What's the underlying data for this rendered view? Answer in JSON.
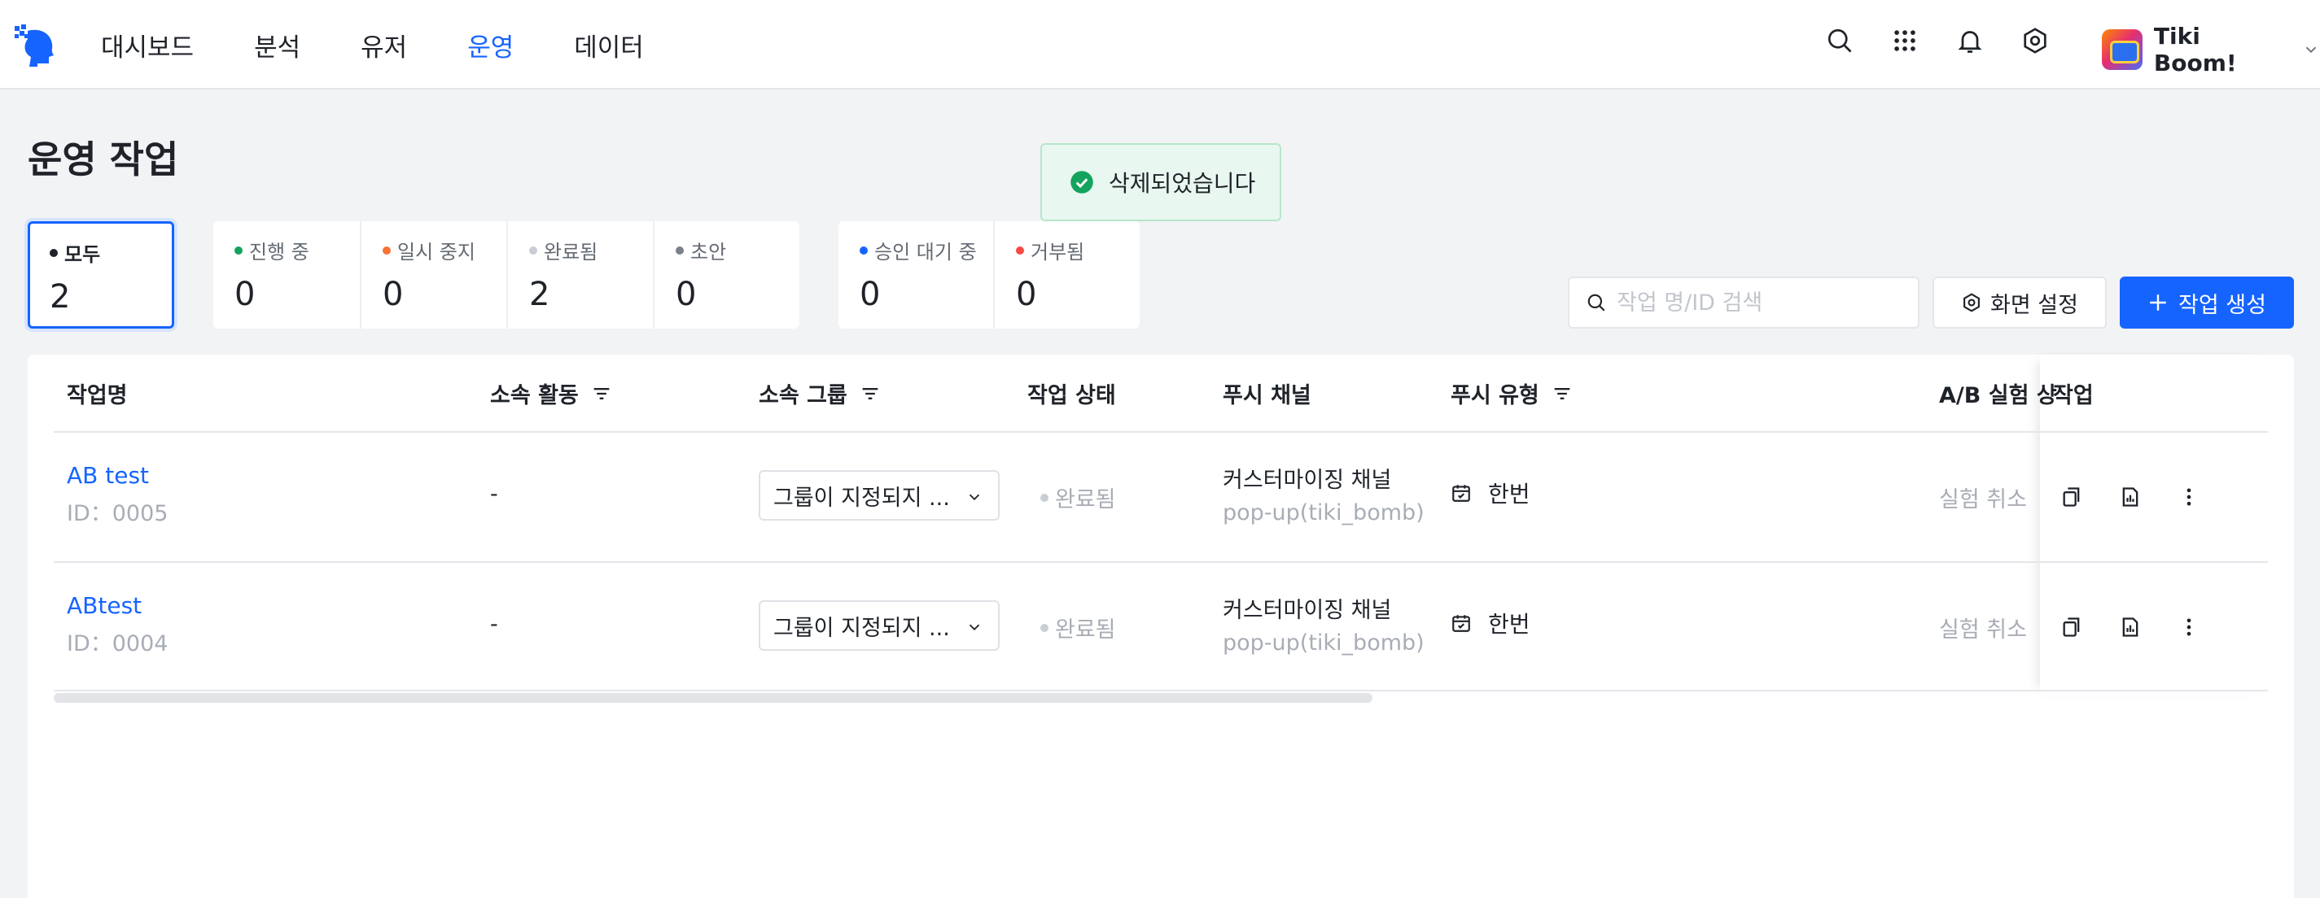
{
  "nav": {
    "items": [
      "대시보드",
      "분석",
      "유저",
      "운영",
      "데이터"
    ],
    "active": "운영"
  },
  "header_icons": [
    "search-icon",
    "apps-grid-icon",
    "bell-icon",
    "gear-icon"
  ],
  "user": {
    "name": "Tiki Boom!"
  },
  "page": {
    "title": "운영 작업"
  },
  "toast": {
    "message": "삭제되었습니다"
  },
  "status_cards": [
    {
      "label": "모두",
      "count": "2",
      "color": "#1f2329"
    },
    {
      "label": "진행 중",
      "count": "0",
      "color": "#14a35e"
    },
    {
      "label": "일시 중지",
      "count": "0",
      "color": "#f77234"
    },
    {
      "label": "완료됨",
      "count": "2",
      "color": "#c9cdd4"
    },
    {
      "label": "초안",
      "count": "0",
      "color": "#7a7f89"
    },
    {
      "label": "승인 대기 중",
      "count": "0",
      "color": "#1664ff"
    },
    {
      "label": "거부됨",
      "count": "0",
      "color": "#f54a45"
    }
  ],
  "search": {
    "placeholder": "작업 명/ID 검색"
  },
  "toolbar": {
    "settings_label": "화면 설정",
    "create_label": "작업 생성"
  },
  "table": {
    "columns": [
      "작업명",
      "소속 활동",
      "소속 그룹",
      "작업 상태",
      "푸시 채널",
      "푸시 유형",
      "A/B 실험 상",
      "작업"
    ],
    "rows": [
      {
        "name": "AB test",
        "id": "ID：0005",
        "activity": "-",
        "group": "그룹이 지정되지 ...",
        "status": "완료됨",
        "channel": "커스터마이징 채널",
        "channel_sub": "pop-up(tiki_bomb)",
        "push_type": "한번",
        "ab_status": "실험 취소"
      },
      {
        "name": "ABtest",
        "id": "ID：0004",
        "activity": "-",
        "group": "그룹이 지정되지 ...",
        "status": "완료됨",
        "channel": "커스터마이징 채널",
        "channel_sub": "pop-up(tiki_bomb)",
        "push_type": "한번",
        "ab_status": "실험 취소"
      }
    ]
  },
  "colors": {
    "primary": "#1664ff",
    "success": "#14a35e"
  }
}
